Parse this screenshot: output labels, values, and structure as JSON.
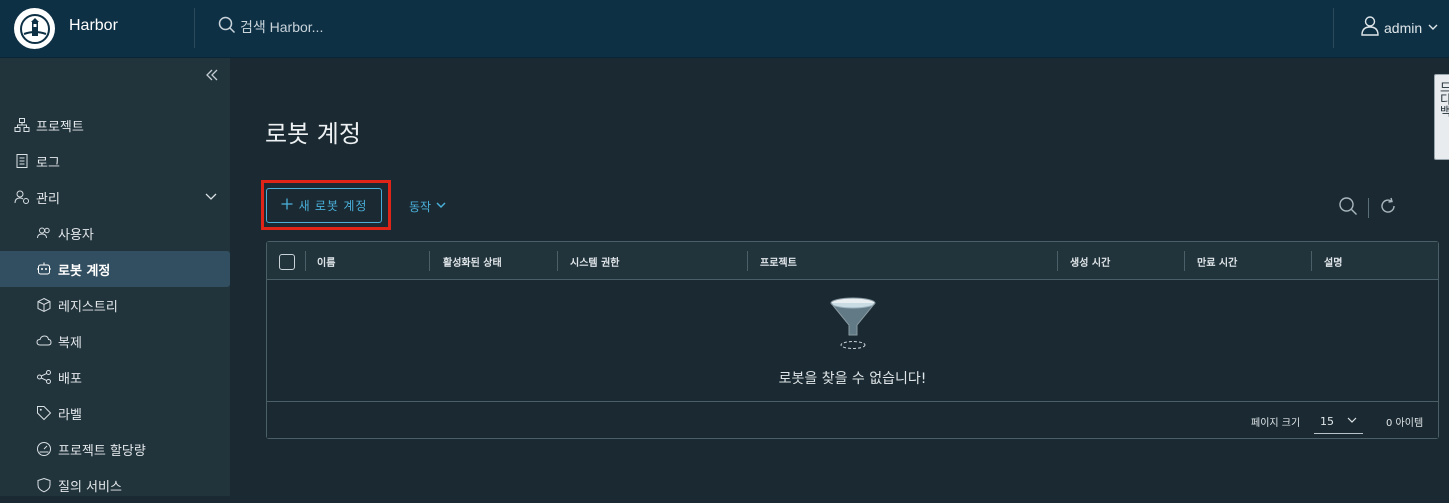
{
  "app": {
    "brand": "Harbor",
    "search_placeholder": "검색 Harbor...",
    "user": "admin"
  },
  "sidebar": {
    "items": [
      {
        "label": "프로젝트",
        "icon": "projects-icon"
      },
      {
        "label": "로그",
        "icon": "logs-icon"
      },
      {
        "label": "관리",
        "icon": "admin-gear-icon"
      },
      {
        "label": "사용자",
        "icon": "users-icon"
      },
      {
        "label": "로봇 계정",
        "icon": "robot-icon",
        "active": true
      },
      {
        "label": "레지스트리",
        "icon": "cube-icon"
      },
      {
        "label": "복제",
        "icon": "cloud-sync-icon"
      },
      {
        "label": "배포",
        "icon": "share-icon"
      },
      {
        "label": "라벨",
        "icon": "tag-icon"
      },
      {
        "label": "프로젝트 할당량",
        "icon": "gauge-icon"
      },
      {
        "label": "질의 서비스",
        "icon": "shield-icon"
      }
    ]
  },
  "main": {
    "title": "로봇 계정",
    "new_button": "새 로봇 계정",
    "action_button": "동작",
    "columns": [
      "이름",
      "활성화된 상태",
      "시스템 권한",
      "프로젝트",
      "생성 시간",
      "만료 시간",
      "설명"
    ],
    "empty_message": "로봇을 찾을 수 없습니다!",
    "footer": {
      "page_size_label": "페이지 크기",
      "page_size": "15",
      "count": "0 아이템"
    }
  },
  "side_tab": {
    "label": "드디백"
  },
  "colors": {
    "topbar": "#0e3045",
    "sidebar": "#21333b",
    "main_bg": "#1b2a32",
    "accent": "#49afd9",
    "highlight_frame": "#e02418"
  }
}
